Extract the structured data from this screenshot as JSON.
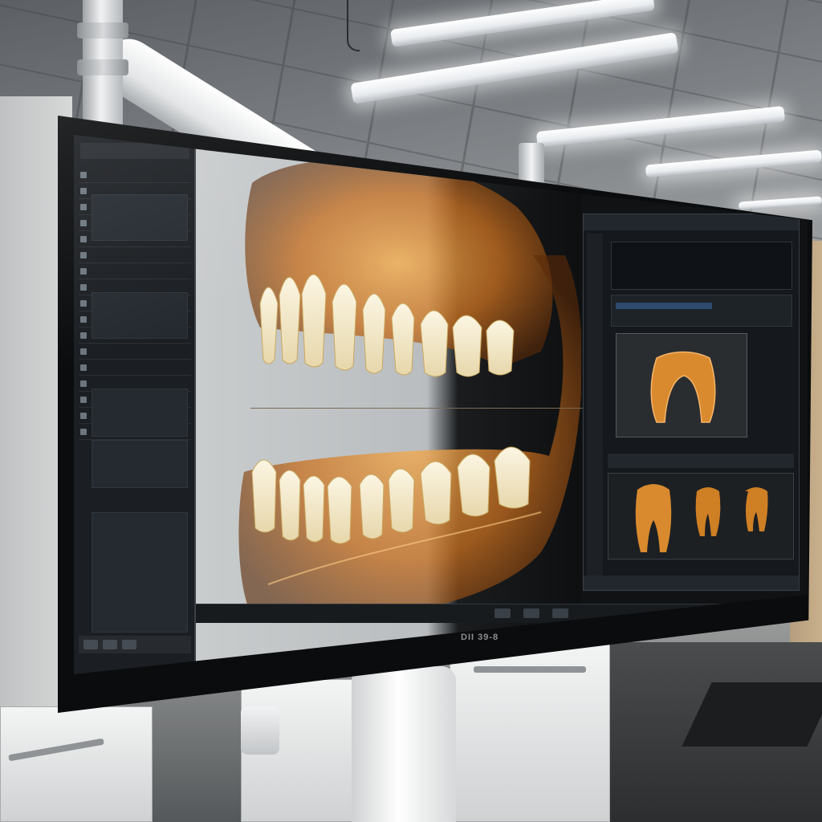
{
  "scene": {
    "monitor_brand": "DII 39-8"
  },
  "software": {
    "top_label": "",
    "footer_label": "",
    "view_label": "",
    "view_bottom_label": "",
    "panel_header": "",
    "left_items": [
      "",
      "",
      "",
      "",
      "",
      "",
      "",
      "",
      "",
      "",
      "",
      "",
      "",
      "",
      "",
      "",
      ""
    ]
  },
  "stand": {
    "label": "",
    "side_label": ""
  },
  "icons": [
    "search-icon",
    "gear-icon",
    "layers-icon",
    "ruler-icon",
    "rotate-icon",
    "zoom-icon"
  ],
  "colors": {
    "bone_orange": "#d98a2e",
    "tooth_ivory": "#efe4c4",
    "screen_bg": "#101214"
  }
}
